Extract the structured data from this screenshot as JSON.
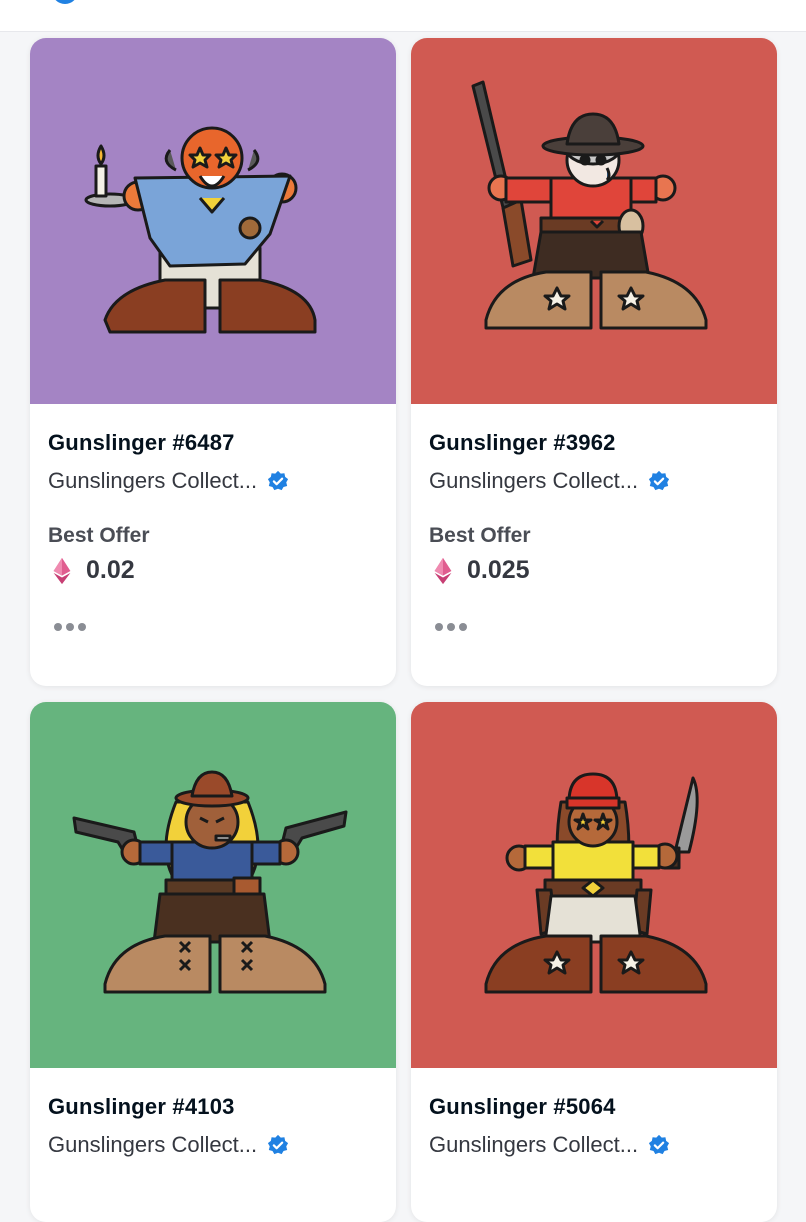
{
  "header": {
    "icon": "partial-logo-icon",
    "icon_color": "#2081e2"
  },
  "cards": [
    {
      "name": "Gunslinger #6487",
      "collection": "Gunslingers Collect...",
      "verified_icon": "verified-badge-icon",
      "offer_label": "Best Offer",
      "price": "0.02",
      "currency_icon": "ethereum-icon",
      "background": "#a484c4"
    },
    {
      "name": "Gunslinger #3962",
      "collection": "Gunslingers Collect...",
      "verified_icon": "verified-badge-icon",
      "offer_label": "Best Offer",
      "price": "0.025",
      "currency_icon": "ethereum-icon",
      "background": "#d05a52"
    },
    {
      "name": "Gunslinger #4103",
      "collection": "Gunslingers Collect...",
      "verified_icon": "verified-badge-icon",
      "background": "#66b47e"
    },
    {
      "name": "Gunslinger #5064",
      "collection": "Gunslingers Collect...",
      "verified_icon": "verified-badge-icon",
      "background": "#d05a52"
    }
  ],
  "colors": {
    "verified": "#2081e2",
    "eth": "#d9487f"
  }
}
